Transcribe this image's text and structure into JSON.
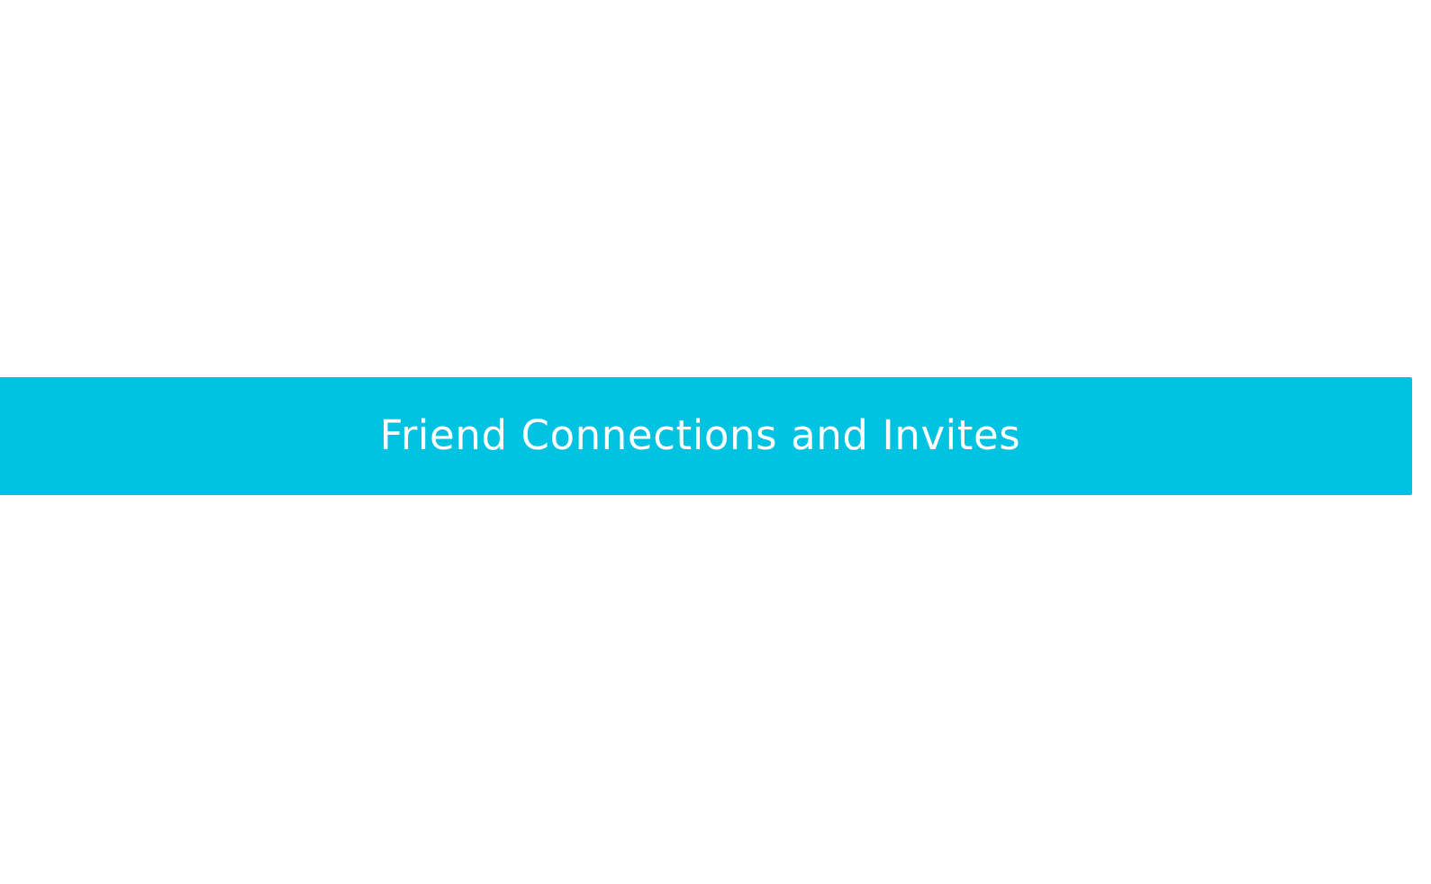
{
  "banner": {
    "title": "Friend Connections and Invites",
    "background_color": "#00c3e1",
    "text_color": "#ffffff"
  },
  "page": {
    "background_color": "#ffffff"
  }
}
